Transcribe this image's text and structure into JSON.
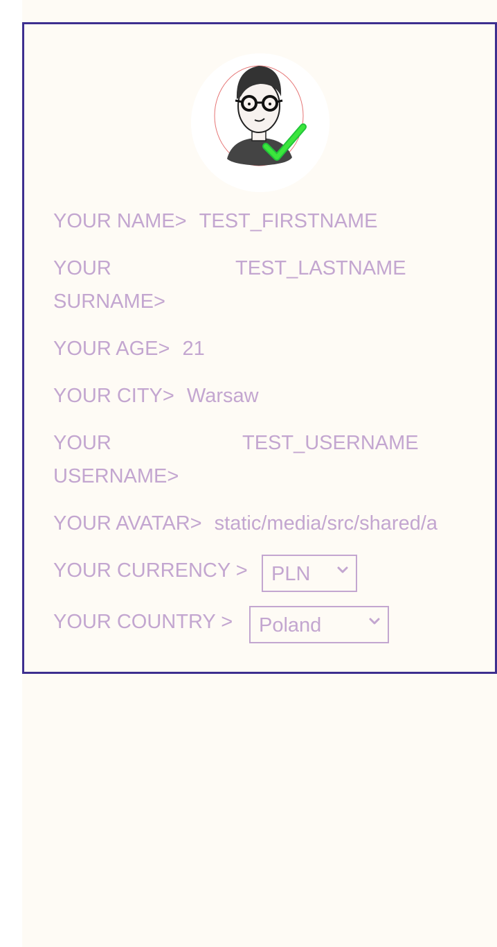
{
  "profile": {
    "avatar_icon": "avatar-with-checkmark-icon",
    "fields": {
      "name": {
        "label": "YOUR NAME>",
        "value": "TEST_FIRSTNAME"
      },
      "surname": {
        "label_line1": "YOUR",
        "label_line2": "SURNAME>",
        "value": "TEST_LASTNAME"
      },
      "age": {
        "label": "YOUR AGE>",
        "value": "21"
      },
      "city": {
        "label": "YOUR CITY>",
        "value": "Warsaw"
      },
      "username": {
        "label_line1": "YOUR",
        "label_line2": "USERNAME>",
        "value": "TEST_USERNAME"
      },
      "avatar": {
        "label": "YOUR AVATAR>",
        "value": "static/media/src/shared/a"
      },
      "currency": {
        "label": "YOUR CURRENCY >",
        "selected": "PLN"
      },
      "country": {
        "label": "YOUR COUNTRY >",
        "selected": "Poland"
      }
    }
  },
  "colors": {
    "border": "#3d2f8f",
    "text": "#c3a6d0",
    "background": "#fefbf5",
    "check": "#3ce63c"
  }
}
